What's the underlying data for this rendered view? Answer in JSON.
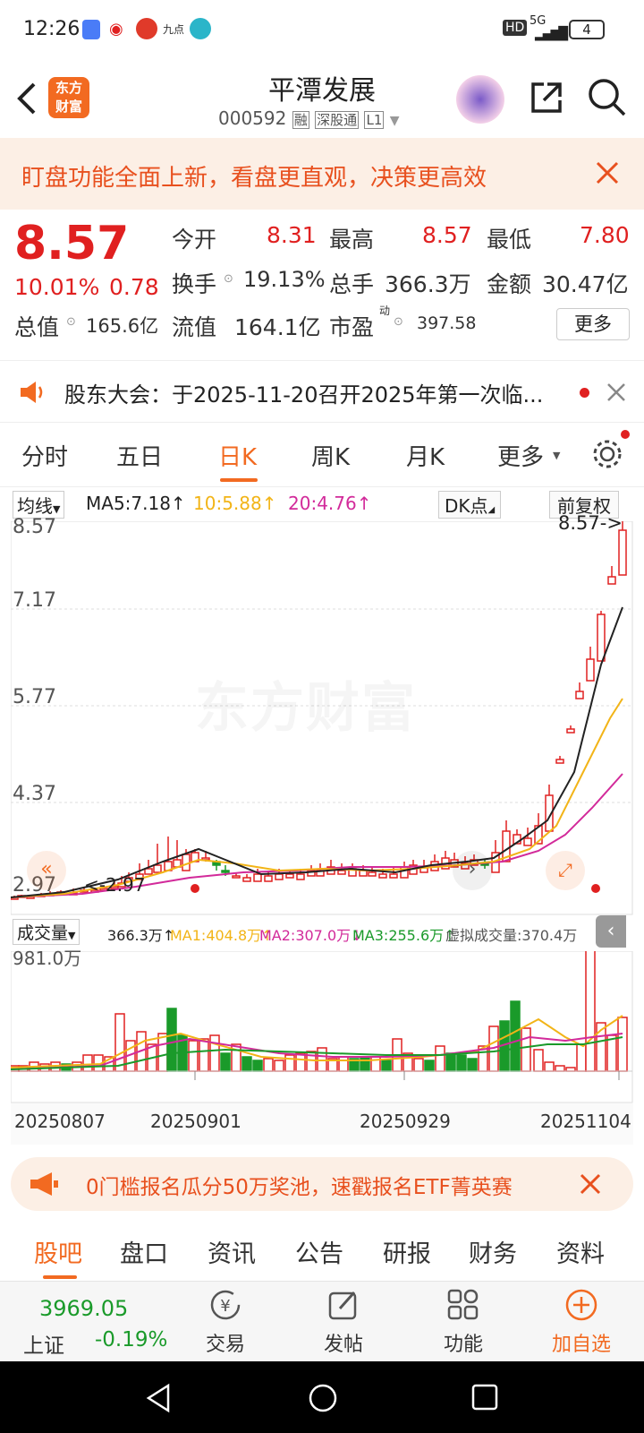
{
  "status": {
    "time": "12:26",
    "network": "5G",
    "battery": "4",
    "hd": "HD"
  },
  "header": {
    "logo_line1": "东方",
    "logo_line2": "财富",
    "title": "平潭发展",
    "code": "000592",
    "badges": [
      "融",
      "深股通",
      "L1"
    ]
  },
  "banner": {
    "text": "盯盘功能全面上新，看盘更直观，决策更高效"
  },
  "quote": {
    "price": "8.57",
    "change_pct": "10.01%",
    "change": "0.78",
    "open_label": "今开",
    "open": "8.31",
    "high_label": "最高",
    "high": "8.57",
    "low_label": "最低",
    "low": "7.80",
    "turnover_label": "换手",
    "turnover": "19.13%",
    "vol_label": "总手",
    "vol": "366.3万",
    "amount_label": "金额",
    "amount": "30.47亿",
    "mcap_label": "总值",
    "mcap": "165.6亿",
    "float_label": "流值",
    "float": "164.1亿",
    "pe_label": "市盈",
    "pe_sup": "动",
    "pe": "397.58",
    "more": "更多"
  },
  "notice": {
    "text": "股东大会：于2025-11-20召开2025年第一次临..."
  },
  "tabs": [
    "分时",
    "五日",
    "日K",
    "周K",
    "月K",
    "更多"
  ],
  "active_tab": "日K",
  "legend": {
    "ma_select": "均线",
    "ma5": "MA5:7.18↑",
    "ma10": "10:5.88↑",
    "ma20": "20:4.76↑",
    "dk": "DK点",
    "fq": "前复权"
  },
  "chart": {
    "y_labels": [
      "8.57",
      "7.17",
      "5.77",
      "4.37",
      "2.97"
    ],
    "last_label": "8.57->",
    "low_label": "<-2.97",
    "watermark": "东方财富"
  },
  "volume": {
    "select": "成交量",
    "vol": "366.3万↑",
    "ma1": "MA1:404.8万↑",
    "ma2": "MA2:307.0万↓",
    "ma3": "MA3:255.6万↑",
    "virtual": "虚拟成交量:370.4万",
    "max_label": "981.0万"
  },
  "dates": [
    "20250807",
    "20250901",
    "20250929",
    "20251104"
  ],
  "promo": {
    "text": "0门槛报名瓜分50万奖池，速戳报名ETF菁英赛"
  },
  "bottom_tabs": [
    "股吧",
    "盘口",
    "资讯",
    "公告",
    "研报",
    "财务",
    "资料"
  ],
  "bottom_bar": {
    "index_value": "3969.05",
    "index_name": "上证",
    "index_change": "-0.19%",
    "trade": "交易",
    "post": "发帖",
    "func": "功能",
    "add": "加自选"
  },
  "colors": {
    "up": "#e02020",
    "down": "#1a9a2a",
    "accent": "#f26a21",
    "ma5": "#222222",
    "ma10": "#f2b417",
    "ma20": "#d22a9a"
  }
}
